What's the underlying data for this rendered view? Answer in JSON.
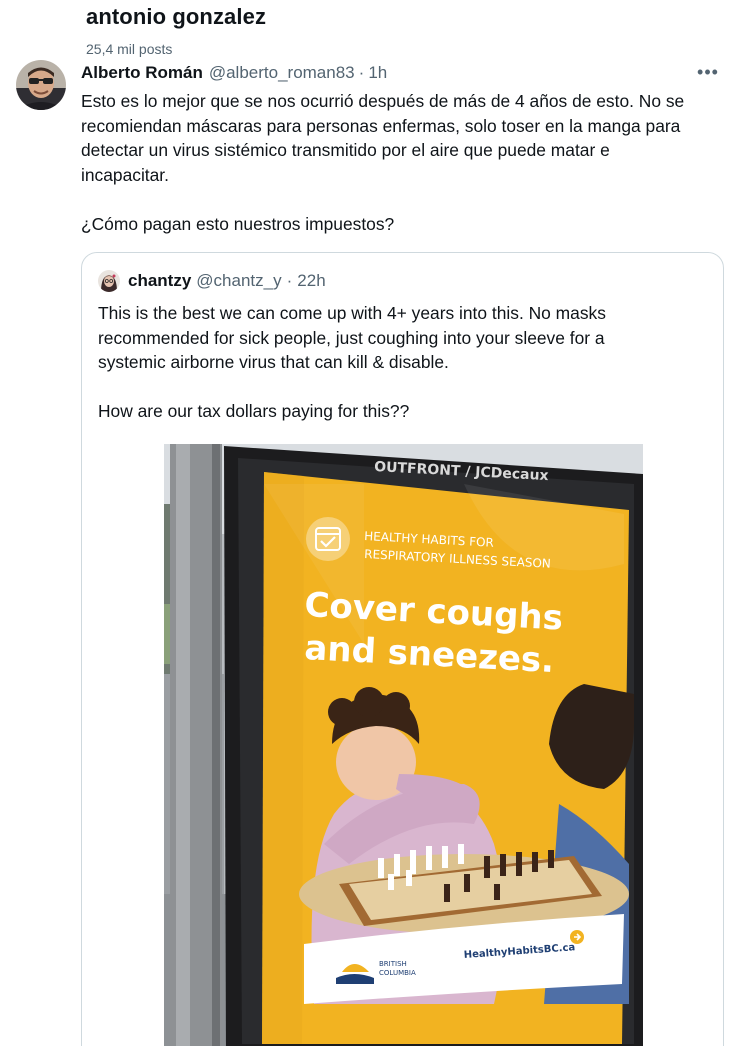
{
  "profile": {
    "name": "antonio gonzalez",
    "post_count": "25,4 mil posts"
  },
  "tweet": {
    "author_name": "Alberto Román",
    "author_handle": "@alberto_roman83",
    "separator": "·",
    "time": "1h",
    "more_icon": "more-horizontal-icon",
    "more_label": "•••",
    "lines": [
      "Esto es lo mejor que se nos ocurrió después de más de 4 años de esto. No se",
      "recomiendan máscaras para personas enfermas, solo toser en la manga para",
      "detectar un virus sistémico transmitido por el aire que puede matar e",
      "incapacitar.",
      "¿Cómo pagan esto nuestros impuestos?"
    ]
  },
  "quote": {
    "author_name": "chantzy",
    "author_handle": "@chantz_y",
    "separator": "·",
    "time": "22h",
    "lines": [
      "This is the best we can come up with 4+ years into this. No masks",
      "recommended for sick people, just coughing into your sleeve for a",
      "systemic airborne virus that can kill & disable.",
      "How are our tax dollars paying for this??"
    ]
  },
  "ad": {
    "operator": "OUTFRONT / JCDecaux",
    "subtitle_1": "HEALTHY HABITS FOR",
    "subtitle_2": "RESPIRATORY ILLNESS SEASON",
    "headline_1": "Cover coughs",
    "headline_2": "and sneezes.",
    "gov_1": "BRITISH",
    "gov_2": "COLUMBIA",
    "url": "HealthyHabitsBC.ca",
    "colors": {
      "poster_yellow": "#f2b321",
      "headline": "#ffffff",
      "frame": "#1c1c1e"
    }
  }
}
